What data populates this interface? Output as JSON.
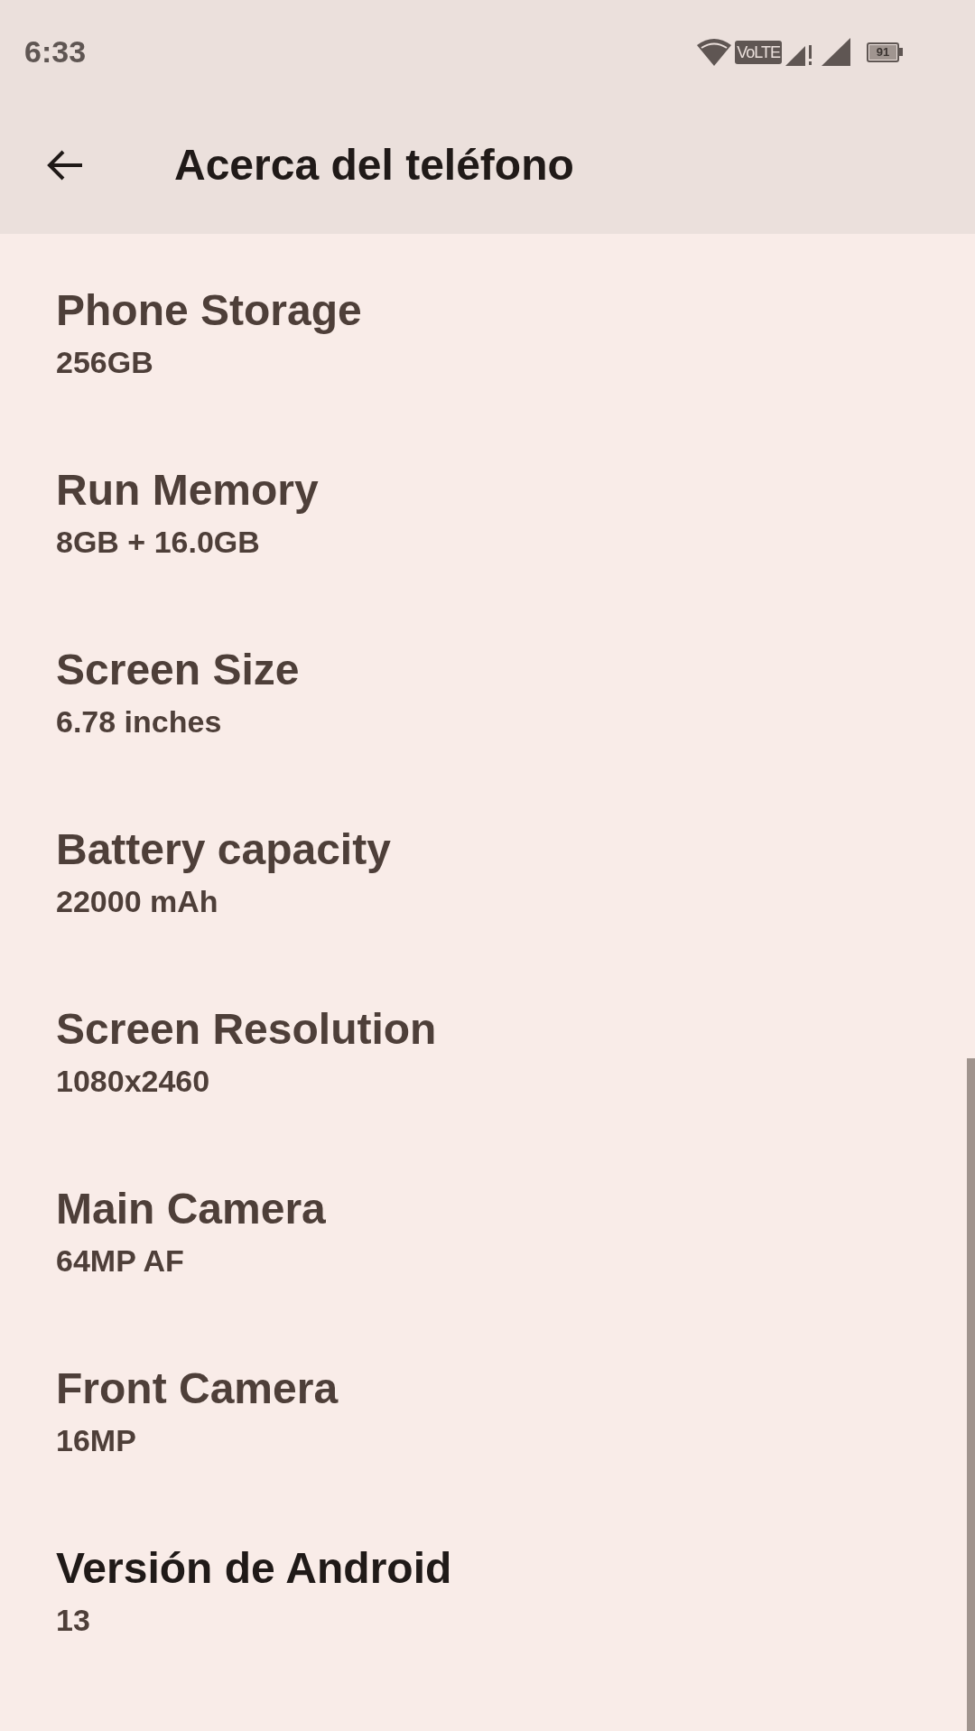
{
  "status_bar": {
    "time": "6:33",
    "volte": "VoLTE",
    "battery": "91"
  },
  "header": {
    "title": "Acerca del teléfono"
  },
  "items": [
    {
      "title": "Phone Storage",
      "value": "256GB",
      "kind": "spec"
    },
    {
      "title": "Run Memory",
      "value": "8GB + 16.0GB",
      "kind": "spec"
    },
    {
      "title": "Screen Size",
      "value": "6.78 inches",
      "kind": "spec"
    },
    {
      "title": "Battery capacity",
      "value": "22000 mAh",
      "kind": "spec"
    },
    {
      "title": "Screen Resolution",
      "value": "1080x2460",
      "kind": "spec"
    },
    {
      "title": "Main Camera",
      "value": "64MP AF",
      "kind": "spec"
    },
    {
      "title": "Front Camera",
      "value": "16MP",
      "kind": "spec"
    },
    {
      "title": "Versión de Android",
      "value": "13",
      "kind": "system"
    }
  ]
}
